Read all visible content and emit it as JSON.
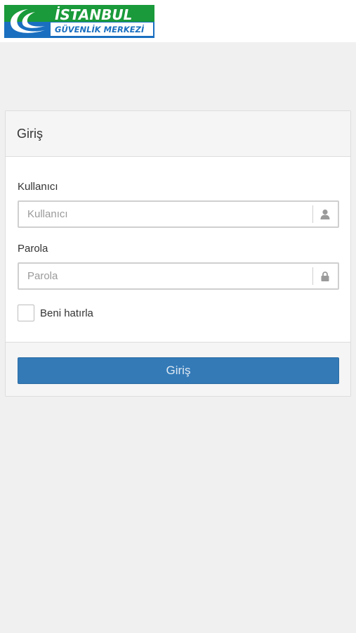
{
  "header": {
    "logo_title": "İSTANBUL",
    "logo_subtitle": "GÜVENLİK MERKEZİ",
    "colors": {
      "green": "#1a9a3a",
      "blue": "#1a6fc0"
    }
  },
  "login_panel": {
    "title": "Giriş",
    "username": {
      "label": "Kullanıcı",
      "placeholder": "Kullanıcı",
      "value": "",
      "icon": "user-icon"
    },
    "password": {
      "label": "Parola",
      "placeholder": "Parola",
      "value": "",
      "icon": "lock-icon"
    },
    "remember": {
      "label": "Beni hatırla",
      "checked": false
    },
    "submit_label": "Giriş",
    "accent": "#337ab7"
  }
}
